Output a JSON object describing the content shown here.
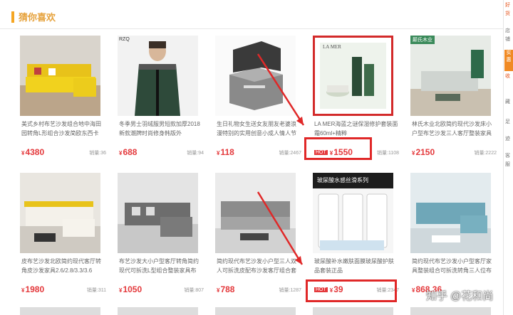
{
  "header": {
    "title": "猜你喜欢"
  },
  "products": [
    {
      "name": "美式乡村布艺沙发组合地中海田园转角L形组合沙发简欧东西卡",
      "price": "4380",
      "sales": "销量:36",
      "hot": false
    },
    {
      "name": "冬季男士羽绒服男短款加厚2018新款潮牌时尚修身韩版外",
      "price": "688",
      "sales": "销量:94",
      "hot": false
    },
    {
      "name": "生日礼物女生送女友朋友老婆浪漫特别的实用创意小成人情人节",
      "price": "118",
      "sales": "销量:2467",
      "hot": false
    },
    {
      "name": "LA MER海蓝之谜保湿修护套装面霜60ml+精粹",
      "price": "1550",
      "sales": "销量:1108",
      "hot": true
    },
    {
      "name": "林氏木业北欧简约现代沙发床小户型布艺沙发三人客厅整装家具",
      "price": "2150",
      "sales": "销量:2222",
      "hot": false
    },
    {
      "name": "皮布艺沙发北欧简约现代客厅转角皮沙发家具2.6/2.8/3.3/3.6",
      "price": "1980",
      "sales": "销量:311",
      "hot": false
    },
    {
      "name": "布艺沙发大小户型客厅转角简约现代可拆洗L型组合整装家具布",
      "price": "1050",
      "sales": "销量:807",
      "hot": false
    },
    {
      "name": "简约现代布艺沙发小户型三人双人可拆洗皮配布沙发客厅组合套",
      "price": "788",
      "sales": "销量:1287",
      "hot": false
    },
    {
      "name": "玻尿酸补水嫩肤面膜玻尿酸护肤品套装正品",
      "price": "39",
      "sales": "销量:2347",
      "hot": true
    },
    {
      "name": "简约现代布艺沙发小户型客厅家具整装组合可拆洗转角三人位布",
      "price": "868.36",
      "sales": "",
      "hot": false
    }
  ],
  "hot_label": "HOT",
  "currency": "¥",
  "image_texts": {
    "lamer": "LA MER",
    "serum_title": "玻尿酸水感丝滑系列",
    "sofa_tag": "颠氏木业",
    "coat_brand": "RZQ"
  },
  "sidebar": {
    "items": [
      "好",
      "货",
      "店",
      "铺",
      "收",
      "藏",
      "足",
      "迹",
      "客",
      "服"
    ],
    "block_label": "实惠"
  },
  "watermark": "知乎 @花和尚",
  "colors": {
    "accent": "#e6a23c",
    "price": "#e4393c",
    "annotation": "#e02828"
  }
}
